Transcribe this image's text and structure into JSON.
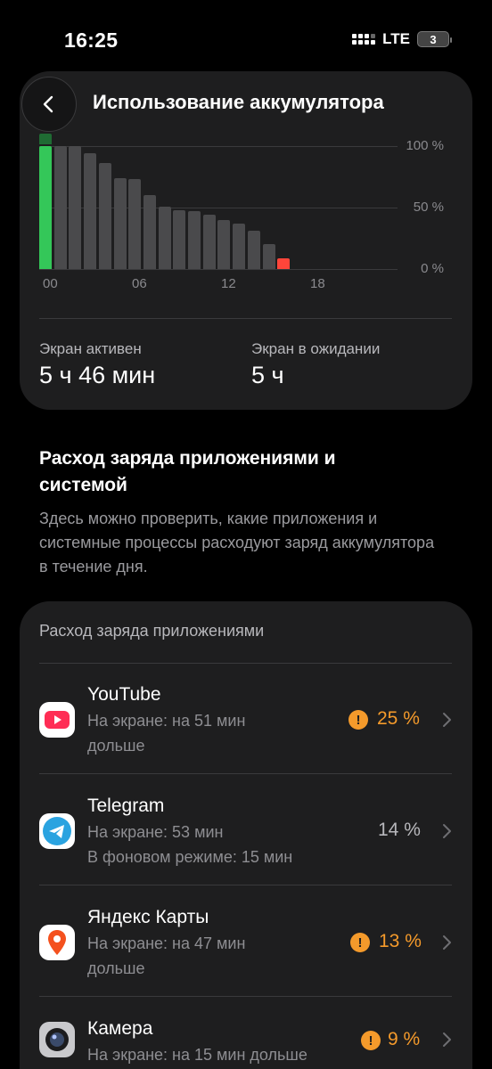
{
  "status_bar": {
    "time": "16:25",
    "network": "LTE",
    "battery": "3"
  },
  "header": {
    "title": "Использование аккумулятора"
  },
  "colors": {
    "accent_warning": "#f49a2b",
    "bar_green": "#34c759",
    "bar_red": "#ff453a",
    "bar_gray": "#4a4a4c"
  },
  "chart_data": {
    "type": "bar",
    "title": "",
    "x_tick_labels": [
      "00",
      "06",
      "12",
      "18"
    ],
    "y_tick_labels": [
      "100 %",
      "50 %",
      "0 %"
    ],
    "ylim": [
      0,
      100
    ],
    "grid": true,
    "bars": [
      {
        "hour": 0,
        "value": 100,
        "color": "green"
      },
      {
        "hour": 1,
        "value": 100,
        "color": "gray"
      },
      {
        "hour": 2,
        "value": 100,
        "color": "gray"
      },
      {
        "hour": 3,
        "value": 94,
        "color": "gray"
      },
      {
        "hour": 4,
        "value": 86,
        "color": "gray"
      },
      {
        "hour": 5,
        "value": 74,
        "color": "gray"
      },
      {
        "hour": 6,
        "value": 73,
        "color": "gray"
      },
      {
        "hour": 7,
        "value": 60,
        "color": "gray"
      },
      {
        "hour": 8,
        "value": 51,
        "color": "gray"
      },
      {
        "hour": 9,
        "value": 48,
        "color": "gray"
      },
      {
        "hour": 10,
        "value": 47,
        "color": "gray"
      },
      {
        "hour": 11,
        "value": 44,
        "color": "gray"
      },
      {
        "hour": 12,
        "value": 40,
        "color": "gray"
      },
      {
        "hour": 13,
        "value": 37,
        "color": "gray"
      },
      {
        "hour": 14,
        "value": 31,
        "color": "gray"
      },
      {
        "hour": 15,
        "value": 20,
        "color": "gray"
      },
      {
        "hour": 16,
        "value": 9,
        "color": "red"
      }
    ]
  },
  "stats": {
    "screen_on_label": "Экран активен",
    "screen_on_value": "5 ч 46 мин",
    "screen_idle_label": "Экран в ожидании",
    "screen_idle_value": "5 ч"
  },
  "section": {
    "heading": "Расход заряда приложениями и системой",
    "description": "Здесь можно проверить, какие приложения и системные процессы расходуют заряд аккумулятора в течение дня."
  },
  "apps_card": {
    "title": "Расход заряда приложениями",
    "apps": [
      {
        "name": "YouTube",
        "line1": "На экране: на 51 мин",
        "line2": "дольше",
        "percent": "25 %",
        "warning": true,
        "icon": "youtube-icon"
      },
      {
        "name": "Telegram",
        "line1": "На экране: 53 мин",
        "line2": "В фоновом режиме: 15 мин",
        "percent": "14 %",
        "warning": false,
        "icon": "telegram-icon"
      },
      {
        "name": "Яндекс Карты",
        "line1": "На экране: на 47 мин",
        "line2": "дольше",
        "percent": "13 %",
        "warning": true,
        "icon": "yandex-maps-icon"
      },
      {
        "name": "Камера",
        "line1": "На экране: на 15 мин дольше",
        "line2": "",
        "percent": "9 %",
        "warning": true,
        "icon": "camera-icon"
      }
    ]
  }
}
